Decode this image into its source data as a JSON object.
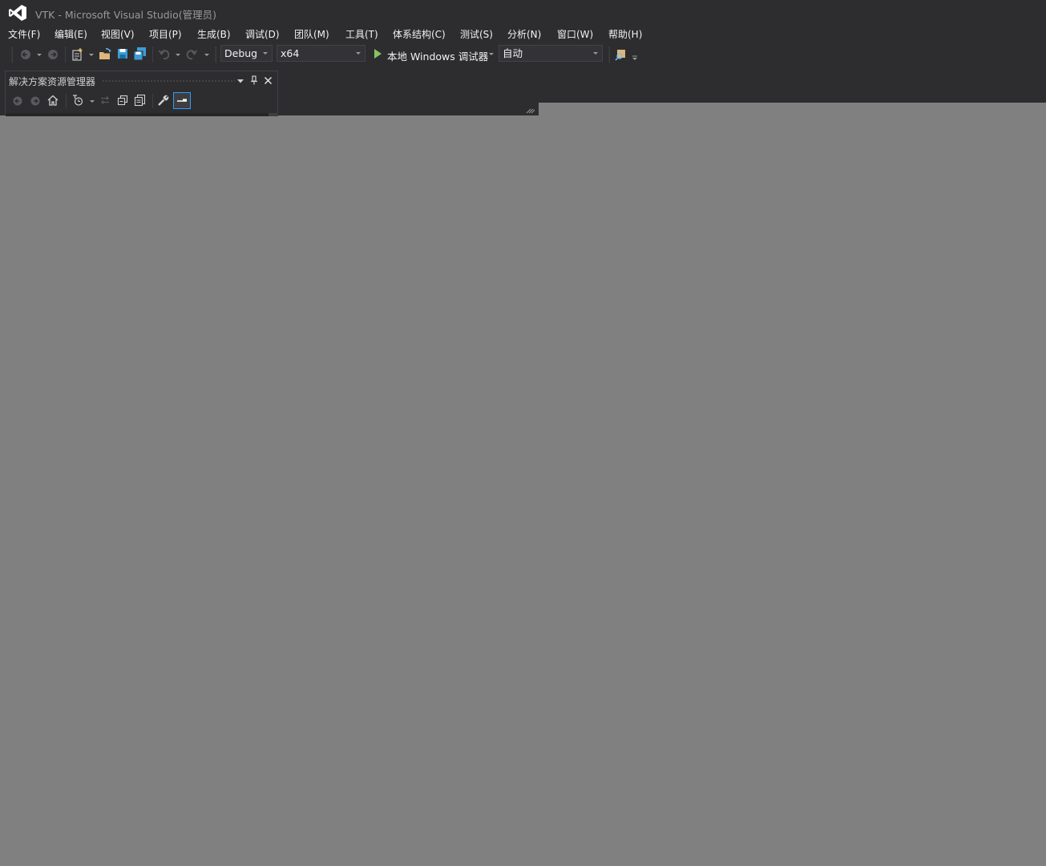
{
  "window": {
    "title": "VTK - Microsoft Visual Studio(管理员)"
  },
  "menu": [
    {
      "label": "文件(F)"
    },
    {
      "label": "编辑(E)"
    },
    {
      "label": "视图(V)"
    },
    {
      "label": "项目(P)"
    },
    {
      "label": "生成(B)"
    },
    {
      "label": "调试(D)"
    },
    {
      "label": "团队(M)"
    },
    {
      "label": "工具(T)"
    },
    {
      "label": "体系结构(C)"
    },
    {
      "label": "测试(S)"
    },
    {
      "label": "分析(N)"
    },
    {
      "label": "窗口(W)"
    },
    {
      "label": "帮助(H)"
    }
  ],
  "toolbar": {
    "configuration": "Debug",
    "platform": "x64",
    "run_label": "本地 Windows 调试器",
    "debug_target": "自动"
  },
  "solution_explorer": {
    "title": "解决方案资源管理器"
  },
  "colors": {
    "chrome": "#2d2d30",
    "workspace": "#808080",
    "accent": "#007acc",
    "run_green": "#8ac25d",
    "logo_white": "#ffffff"
  }
}
